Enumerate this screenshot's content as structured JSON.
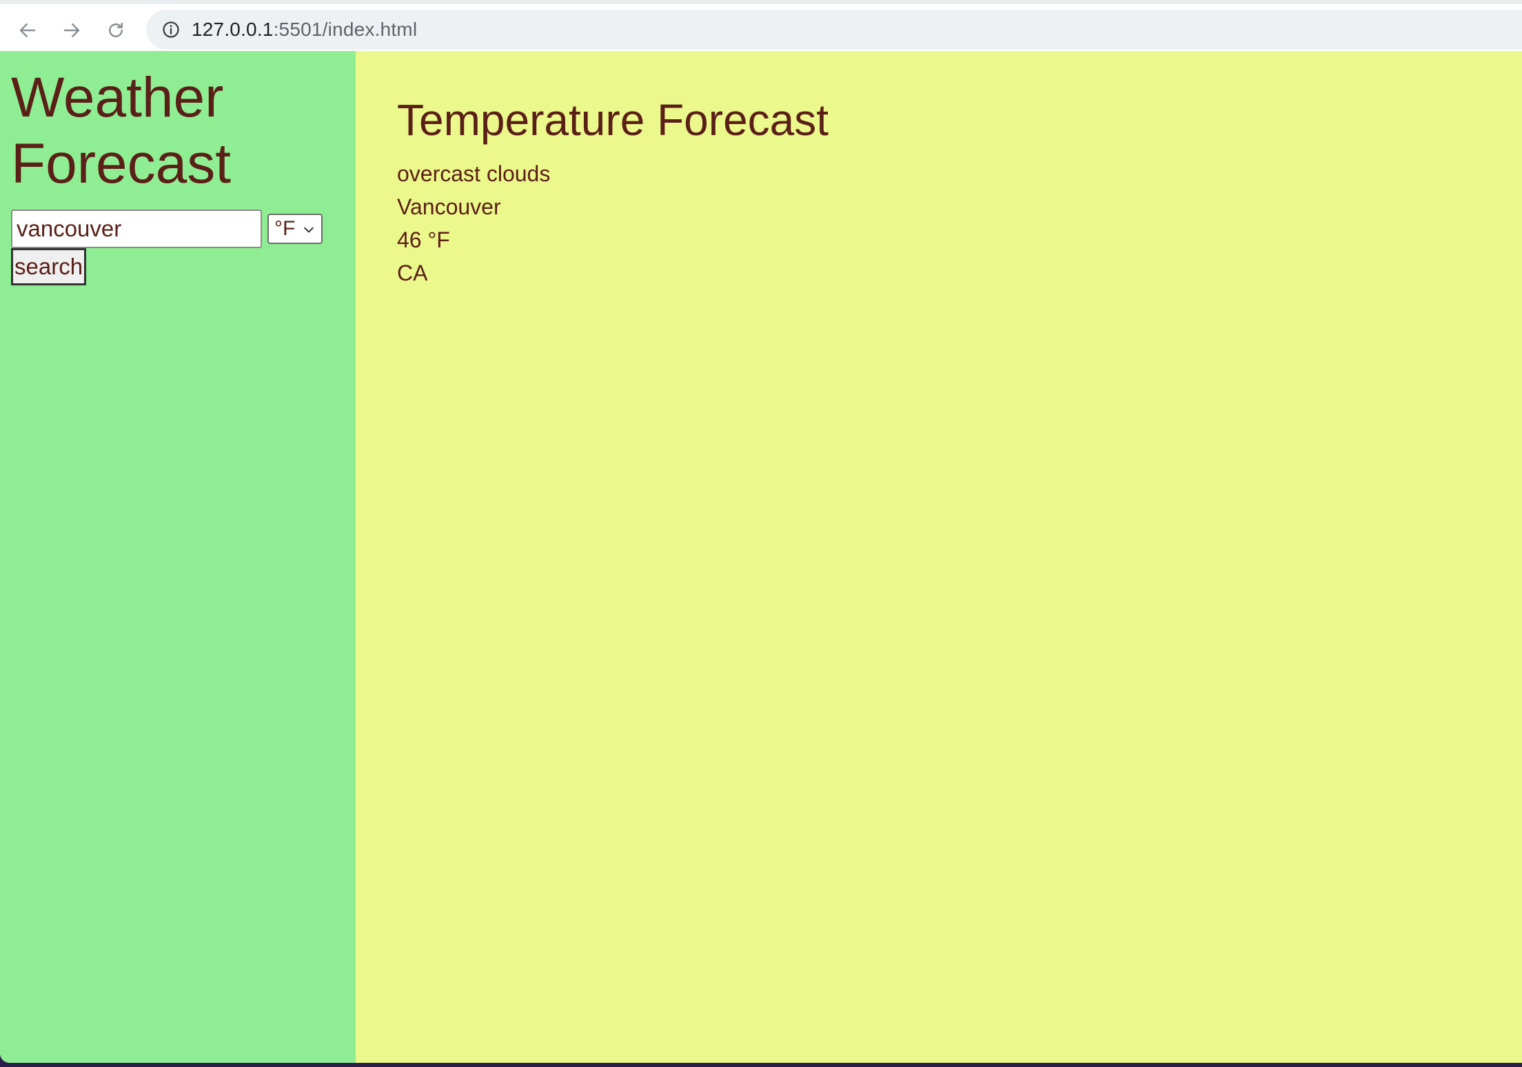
{
  "browser": {
    "url_host": "127.0.0.1",
    "url_path": ":5501/index.html",
    "icons": {
      "back": "arrow-left-icon",
      "forward": "arrow-right-icon",
      "reload": "reload-icon",
      "site_info": "info-icon"
    }
  },
  "sidebar": {
    "title": "Weather Forecast",
    "search_value": "vancouver",
    "unit_selected": "°F",
    "search_label": "search"
  },
  "main": {
    "title": "Temperature Forecast",
    "description": "overcast clouds",
    "city": "Vancouver",
    "temperature": "46 °F",
    "country": "CA"
  },
  "colors": {
    "sidebar_bg": "#8fee93",
    "main_bg": "#ebf88b",
    "text": "#5a1f17"
  }
}
